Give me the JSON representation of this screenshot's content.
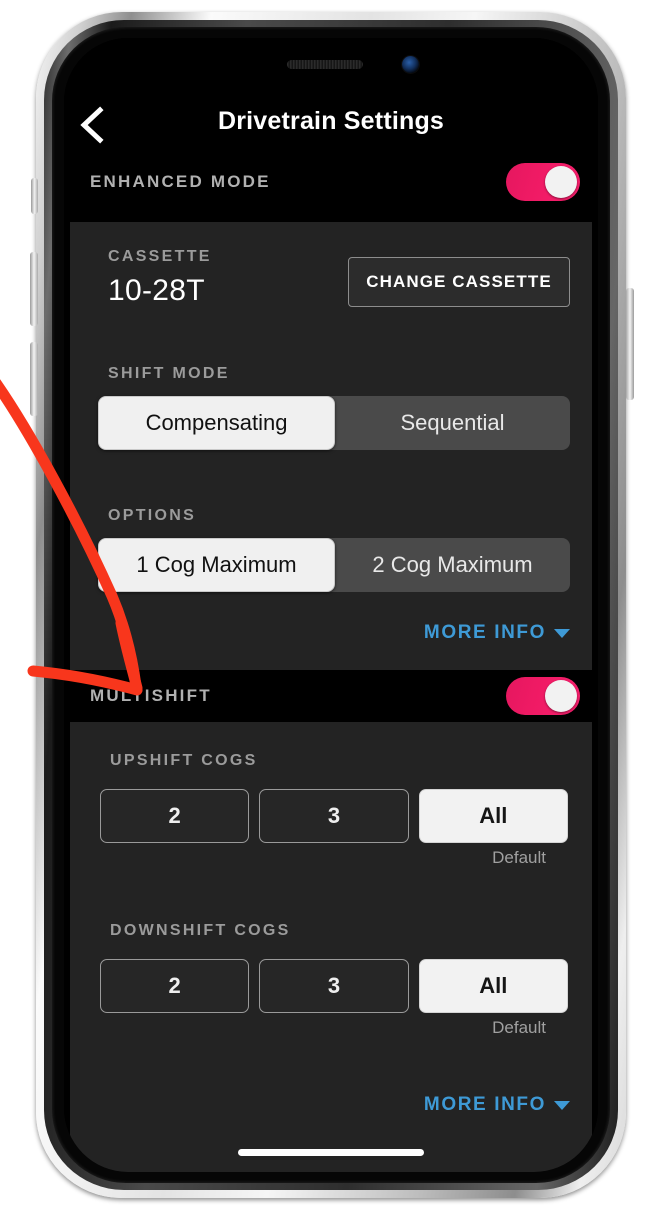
{
  "nav": {
    "back_icon": "chevron-left-icon",
    "title": "Drivetrain Settings"
  },
  "enhanced_mode": {
    "label": "ENHANCED MODE",
    "toggle_on": true,
    "cassette": {
      "label": "CASSETTE",
      "value": "10-28T",
      "change_button": "CHANGE CASSETTE"
    },
    "shift_mode": {
      "label": "SHIFT MODE",
      "options": [
        "Compensating",
        "Sequential"
      ],
      "selected": "Compensating"
    },
    "options": {
      "label": "OPTIONS",
      "options": [
        "1 Cog Maximum",
        "2 Cog Maximum"
      ],
      "selected": "1 Cog Maximum"
    },
    "more_info": "MORE INFO"
  },
  "multishift": {
    "label": "MULTISHIFT",
    "toggle_on": true,
    "upshift": {
      "label": "UPSHIFT COGS",
      "options": [
        "2",
        "3",
        "All"
      ],
      "selected": "All",
      "default_caption": "Default"
    },
    "downshift": {
      "label": "DOWNSHIFT COGS",
      "options": [
        "2",
        "3",
        "All"
      ],
      "selected": "All",
      "default_caption": "Default"
    },
    "more_info": "MORE INFO"
  },
  "colors": {
    "toggle_on": "#ef1a64",
    "link": "#3e9ad6",
    "panel": "#232323",
    "screen_bg": "#000000",
    "annotation": "#f8361c"
  },
  "annotation": {
    "type": "hand-drawn-arrow",
    "points_at": "MULTISHIFT"
  }
}
